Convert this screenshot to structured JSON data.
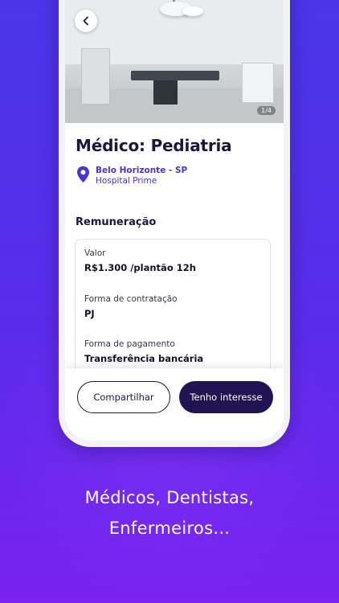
{
  "gallery": {
    "counter": "1/4"
  },
  "job": {
    "title": "Médico: Pediatria",
    "city": "Belo Horizonte - SP",
    "hospital": "Hospital Prime"
  },
  "remuneration": {
    "section_title": "Remuneração",
    "fields": [
      {
        "label": "Valor",
        "value": "R$1.300 /plantão 12h"
      },
      {
        "label": "Forma de contratação",
        "value": "PJ"
      },
      {
        "label": "Forma de pagamento",
        "value": "Transferência bancária"
      }
    ]
  },
  "actions": {
    "share_label": "Compartilhar",
    "interest_label": "Tenho interesse"
  },
  "promo": {
    "line1": "Médicos, Dentistas,",
    "line2": "Enfermeiros..."
  },
  "colors": {
    "accent": "#4b34d6",
    "primary_dark": "#201452",
    "background_gradient_start": "#4a36e8",
    "background_gradient_end": "#7a22ef"
  },
  "icons": {
    "back": "chevron-left-icon",
    "location": "map-pin-icon"
  }
}
